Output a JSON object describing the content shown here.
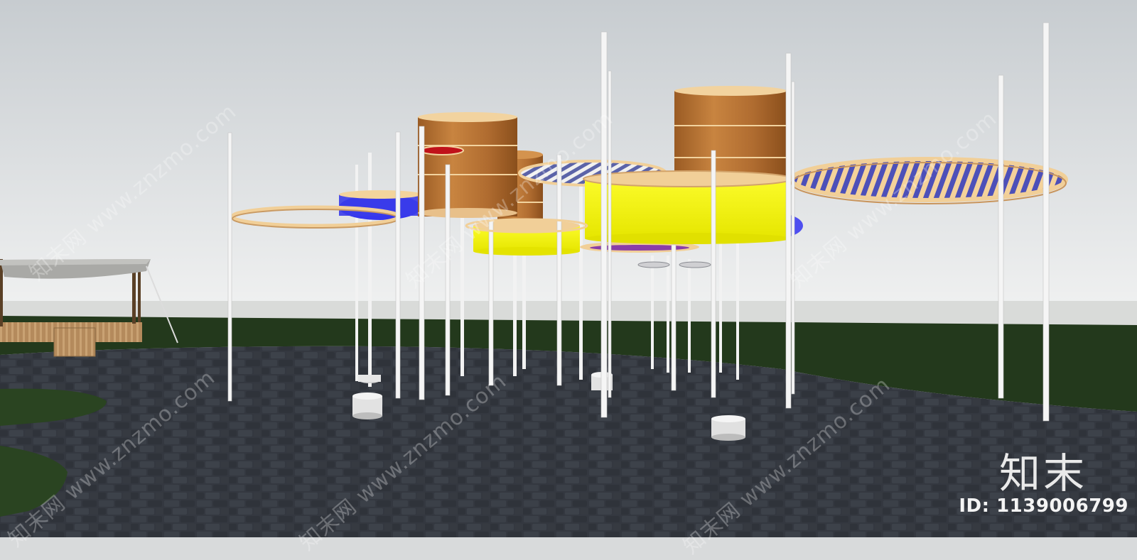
{
  "watermark": {
    "brand": "知末",
    "id_label": "ID: 1139006799",
    "tiled_text": "知末网 www.znzmo.com"
  },
  "colors": {
    "sky_top": "#c9cfd3",
    "sky_bottom": "#eef0f0",
    "grass": "#24391d",
    "pavement": "#33373d",
    "copper": "#b9773a",
    "ring": "#f1cf98",
    "yellow": "#f3f20c",
    "blue": "#3c3df0",
    "pole": "#f4f4f4"
  }
}
